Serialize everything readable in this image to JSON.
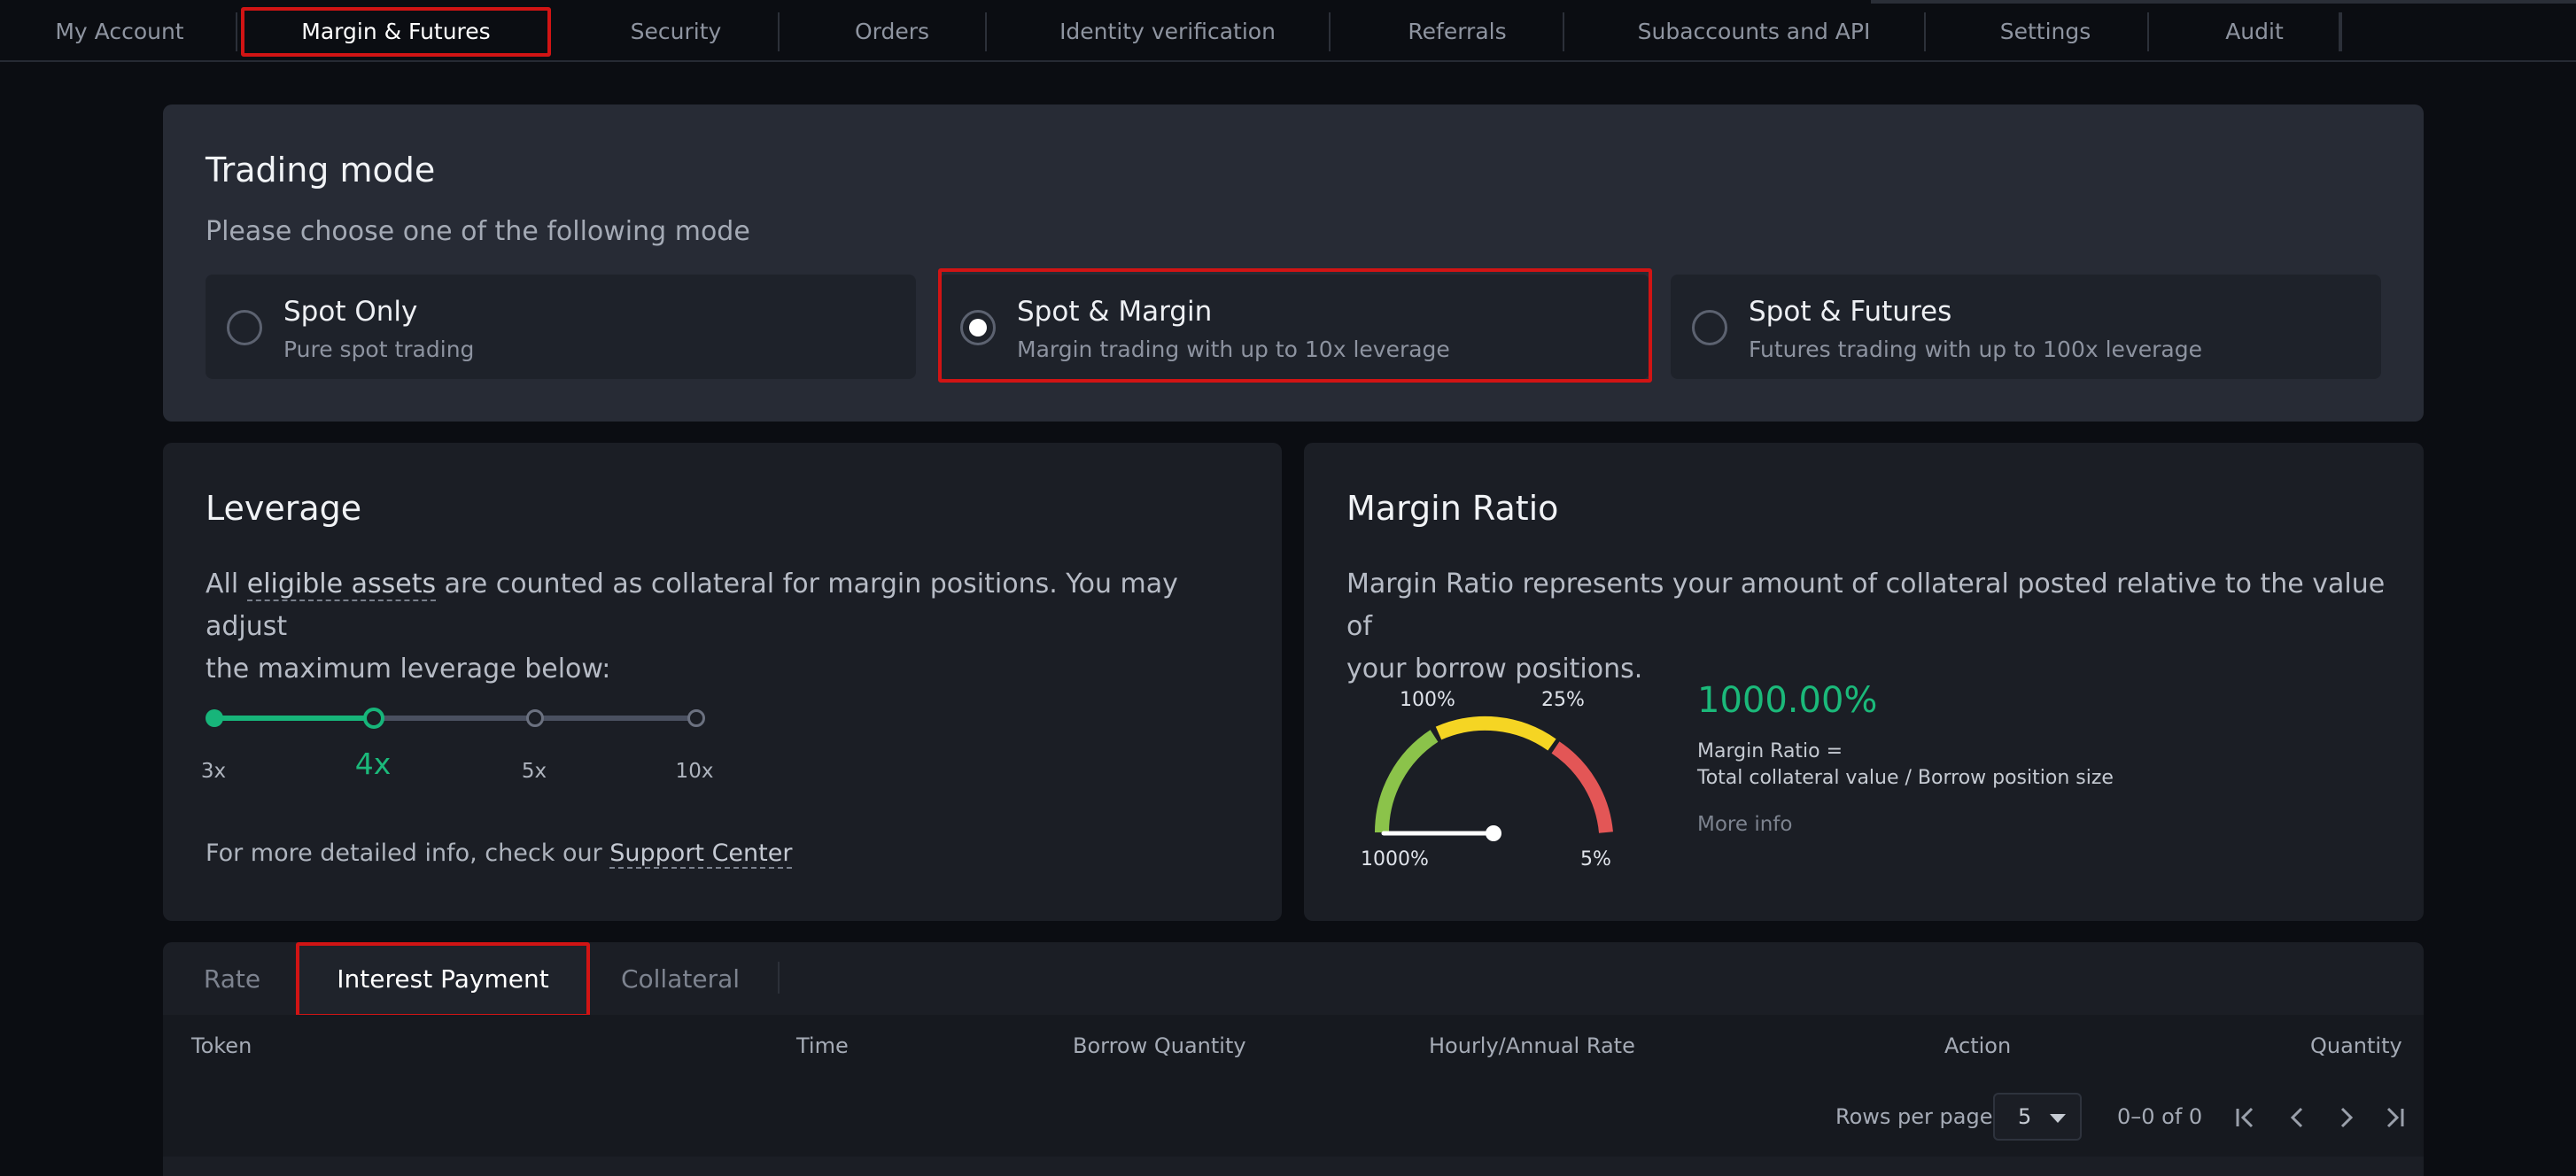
{
  "nav": {
    "tabs": [
      {
        "label": "My Account"
      },
      {
        "label": "Margin & Futures"
      },
      {
        "label": "Security"
      },
      {
        "label": "Orders"
      },
      {
        "label": "Identity verification"
      },
      {
        "label": "Referrals"
      },
      {
        "label": "Subaccounts and API"
      },
      {
        "label": "Settings"
      },
      {
        "label": "Audit"
      }
    ],
    "active_tab": "Margin & Futures"
  },
  "trading_mode": {
    "title": "Trading mode",
    "subtitle": "Please choose one of the following mode",
    "options": [
      {
        "title": "Spot Only",
        "desc": "Pure spot trading",
        "selected": false
      },
      {
        "title": "Spot & Margin",
        "desc": "Margin trading with up to 10x leverage",
        "selected": true
      },
      {
        "title": "Spot & Futures",
        "desc": "Futures trading with up to 100x leverage",
        "selected": false
      }
    ]
  },
  "leverage": {
    "title": "Leverage",
    "text_prefix": "All ",
    "text_link": "eligible assets",
    "text_suffix_line1": " are counted as collateral for margin positions. You may adjust",
    "text_line2": "the maximum leverage below:",
    "stops": [
      "3x",
      "4x",
      "5x",
      "10x"
    ],
    "selected": "4x",
    "info_prefix": "For more detailed info, check our ",
    "info_link": "Support Center"
  },
  "margin_ratio": {
    "title": "Margin Ratio",
    "desc_line1": "Margin Ratio represents your amount of collateral posted relative to the value of",
    "desc_line2": "your borrow positions.",
    "value": "1000.00%",
    "formula_line1": "Margin Ratio =",
    "formula_line2": "Total collateral value / Borrow position size",
    "more_info": "More info",
    "gauge_labels": {
      "far_left": "1000%",
      "top_left": "100%",
      "top_right": "25%",
      "far_right": "5%"
    },
    "colors": {
      "green": "#8bc34a",
      "yellow": "#f5d523",
      "red": "#e35656",
      "accent": "#1bb97a"
    }
  },
  "table": {
    "tabs": [
      {
        "label": "Rate"
      },
      {
        "label": "Interest Payment"
      },
      {
        "label": "Collateral"
      }
    ],
    "active_tab": "Interest Payment",
    "columns": [
      "Token",
      "Time",
      "Borrow Quantity",
      "Hourly/Annual Rate",
      "Action",
      "Quantity"
    ],
    "rows": [],
    "pagination": {
      "rows_per_page_label": "Rows per page",
      "rows_per_page": "5",
      "range": "0–0 of 0"
    }
  }
}
